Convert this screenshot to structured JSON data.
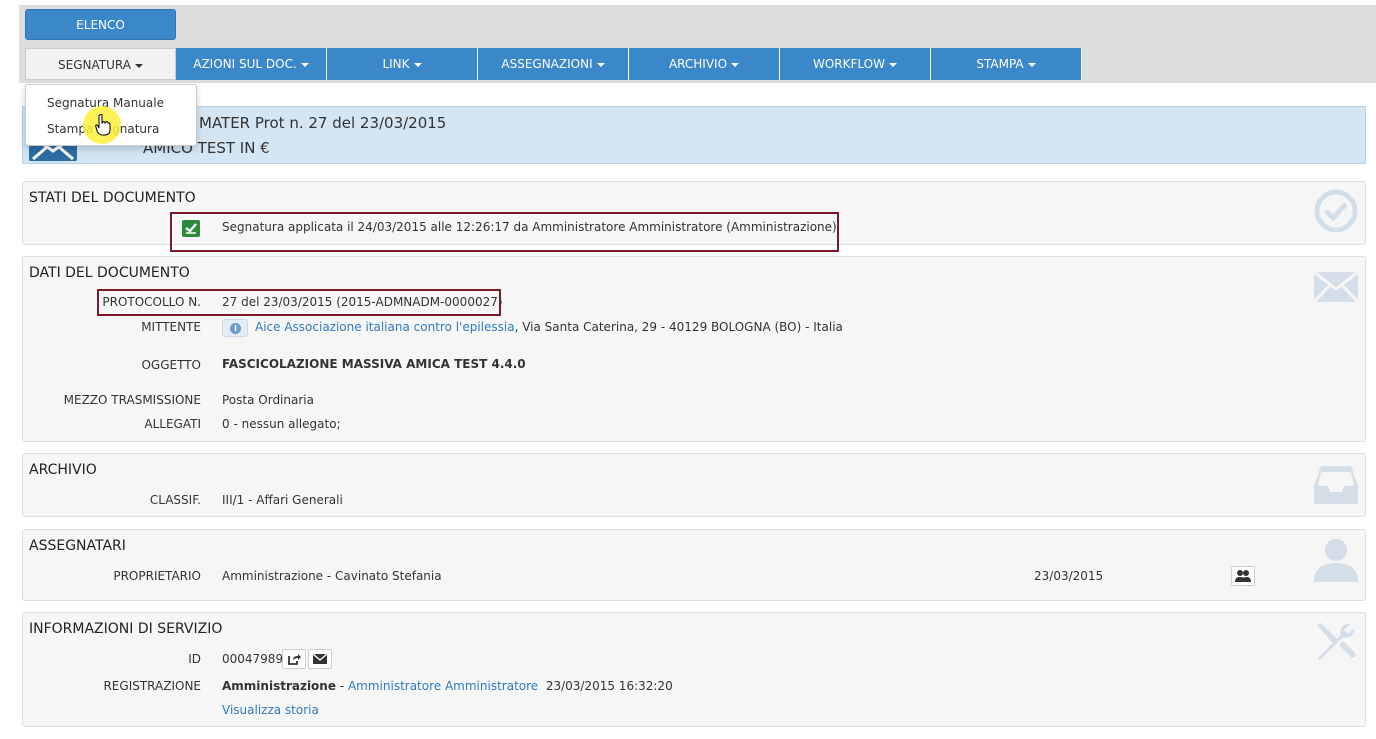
{
  "toolbar": {
    "elenco_label": "ELENCO"
  },
  "tabs": [
    {
      "label": "SEGNATURA"
    },
    {
      "label": "AZIONI SUL DOC."
    },
    {
      "label": "LINK"
    },
    {
      "label": "ASSEGNAZIONI"
    },
    {
      "label": "ARCHIVIO"
    },
    {
      "label": "WORKFLOW"
    },
    {
      "label": "STAMPA"
    }
  ],
  "dropdown": {
    "items": [
      "Segnatura Manuale",
      "Stampa Segnatura"
    ]
  },
  "doc_header": {
    "title": "MATER Prot n. 27 del 23/03/2015",
    "subtitle": "AMICO TEST IN €"
  },
  "stati": {
    "title": "STATI DEL DOCUMENTO",
    "status_text": "Segnatura applicata il 24/03/2015 alle 12:26:17 da Amministratore Amministratore (Amministrazione)"
  },
  "dati": {
    "title": "DATI DEL DOCUMENTO",
    "protocollo_label": "PROTOCOLLO N.",
    "protocollo_value": "27 del 23/03/2015 (2015-ADMNADM-0000027)",
    "mittente_label": "MITTENTE",
    "mittente_link": "Aice Associazione italiana contro l'epilessia",
    "mittente_address": ", Via Santa Caterina, 29 - 40129 BOLOGNA (BO) - Italia",
    "oggetto_label": "OGGETTO",
    "oggetto_value": "FASCICOLAZIONE MASSIVA AMICA TEST 4.4.0",
    "mezzo_label": "MEZZO TRASMISSIONE",
    "mezzo_value": "Posta Ordinaria",
    "allegati_label": "ALLEGATI",
    "allegati_value": "0 - nessun allegato;"
  },
  "archivio": {
    "title": "ARCHIVIO",
    "classif_label": "CLASSIF.",
    "classif_value": "III/1 - Affari Generali"
  },
  "assegnatari": {
    "title": "ASSEGNATARI",
    "proprietario_label": "PROPRIETARIO",
    "proprietario_value": "Amministrazione - Cavinato Stefania",
    "date": "23/03/2015"
  },
  "servizio": {
    "title": "INFORMAZIONI DI SERVIZIO",
    "id_label": "ID",
    "id_value": "00047989",
    "registrazione_label": "REGISTRAZIONE",
    "reg_org": "Amministrazione",
    "reg_sep": " - ",
    "reg_user": "Amministratore Amministratore",
    "reg_datetime": "23/03/2015 16:32:20",
    "storia_link": "Visualizza storia"
  },
  "colors": {
    "accent": "#3a87c9",
    "header_bg": "#d4e6f4",
    "highlight_border": "#7a1a2a",
    "check_green": "#2c8a3c"
  }
}
